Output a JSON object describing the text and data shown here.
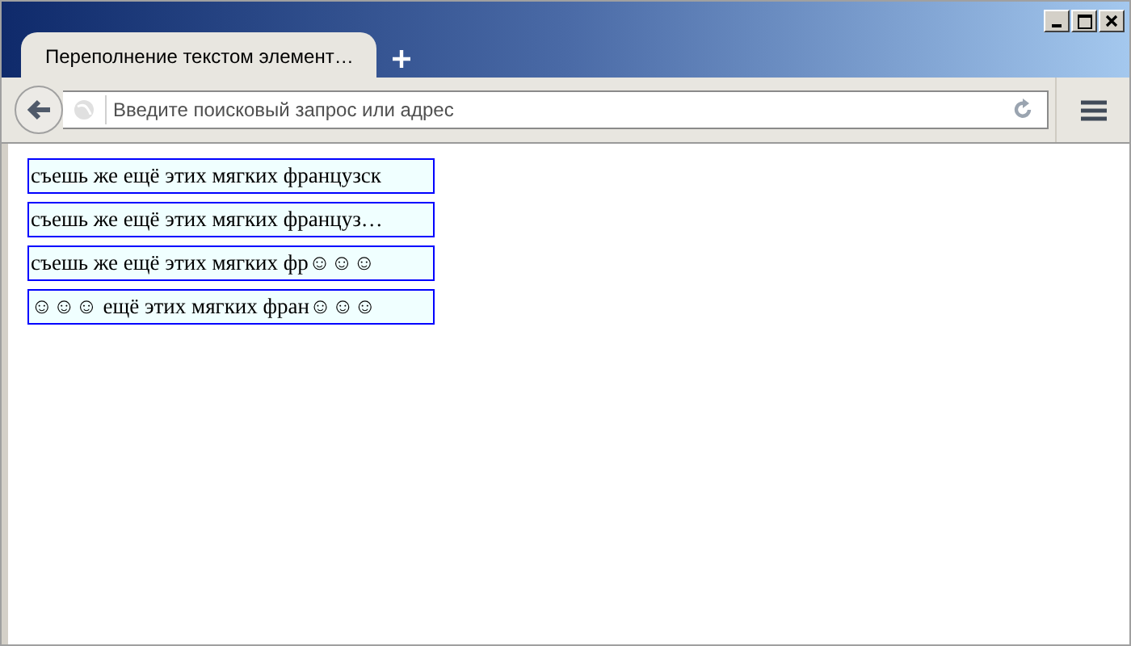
{
  "tabs": [
    {
      "title": "Переполнение текстом элемент…",
      "selected": true
    }
  ],
  "address_bar": {
    "placeholder": "Введите поисковый запрос или адрес"
  },
  "text_boxes": [
    "съешь же ещё этих мягких французск",
    "съешь же ещё этих мягких француз…",
    "съешь же ещё этих мягких фр☺☺☺",
    "☺☺☺ ещё этих мягких фран☺☺☺"
  ]
}
